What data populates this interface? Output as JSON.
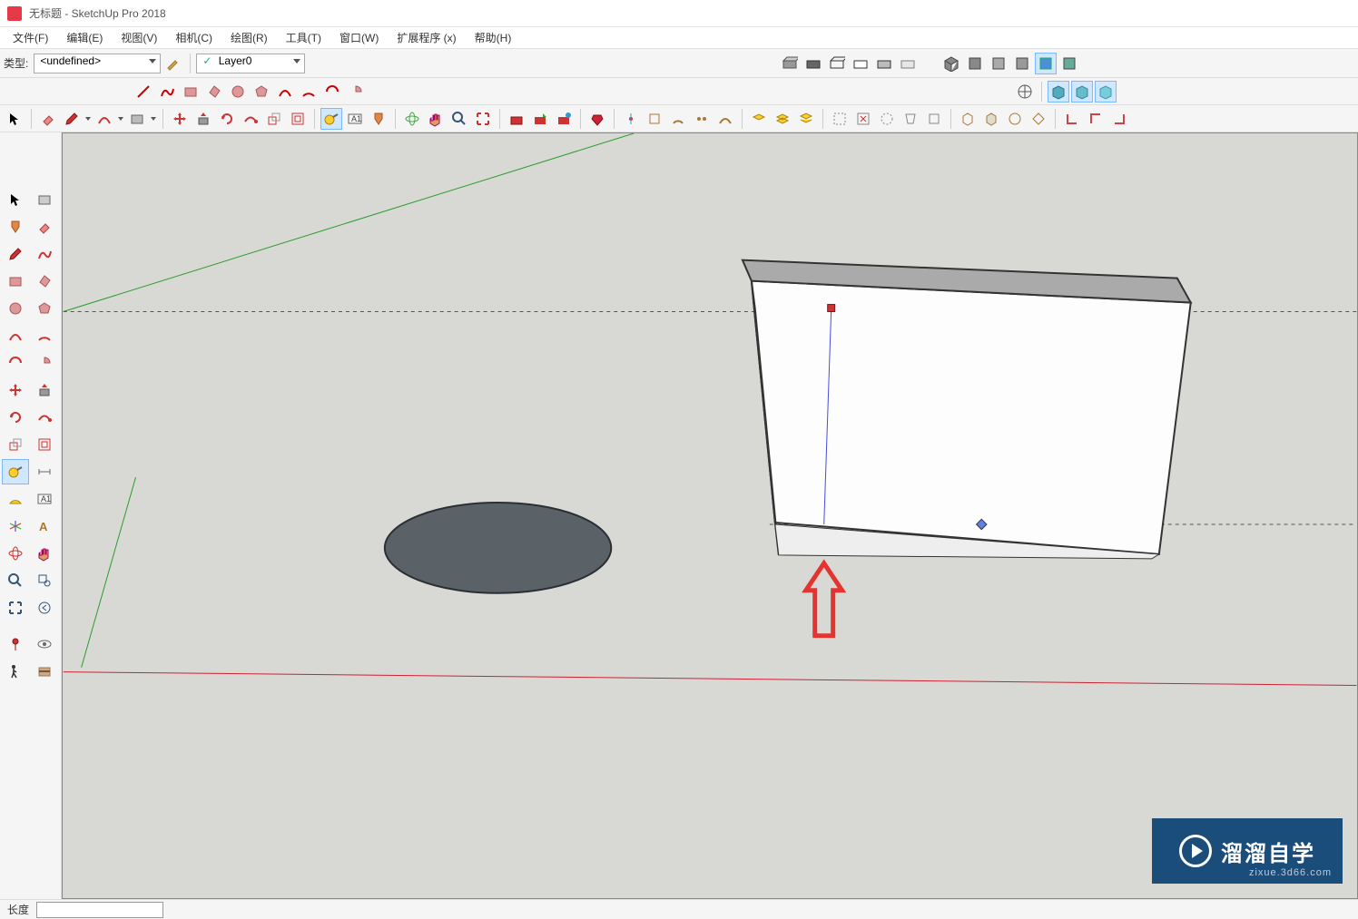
{
  "title": "无标题 - SketchUp Pro 2018",
  "menu": {
    "file": "文件(F)",
    "edit": "编辑(E)",
    "view": "视图(V)",
    "camera": "相机(C)",
    "draw": "绘图(R)",
    "tools": "工具(T)",
    "window": "窗口(W)",
    "extensions": "扩展程序 (x)",
    "help": "帮助(H)"
  },
  "toolbar": {
    "type_label": "类型:",
    "type_value": "<undefined>",
    "layer_value": "Layer0"
  },
  "status": {
    "measure_label": "长度"
  },
  "watermark": {
    "text": "溜溜自学",
    "url": "zixue.3d66.com"
  }
}
